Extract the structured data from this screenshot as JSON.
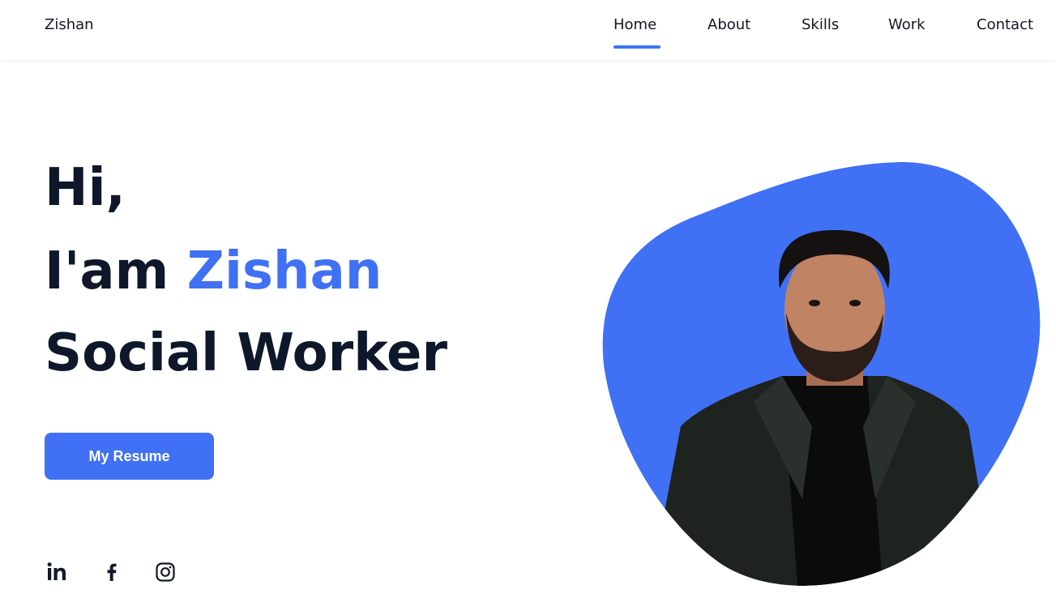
{
  "header": {
    "logo": "Zishan",
    "nav": [
      {
        "label": "Home",
        "active": true
      },
      {
        "label": "About"
      },
      {
        "label": "Skills"
      },
      {
        "label": "Work"
      },
      {
        "label": "Contact"
      }
    ]
  },
  "hero": {
    "greeting": "Hi,",
    "intro_prefix": "I'am ",
    "name": "Zishan",
    "title": "Social Worker",
    "resume_button": "My Resume"
  },
  "social": [
    {
      "icon": "linkedin-icon"
    },
    {
      "icon": "facebook-icon"
    },
    {
      "icon": "instagram-icon"
    }
  ],
  "colors": {
    "accent": "#4070f4",
    "text": "#0f172a",
    "background": "#ffffff"
  }
}
